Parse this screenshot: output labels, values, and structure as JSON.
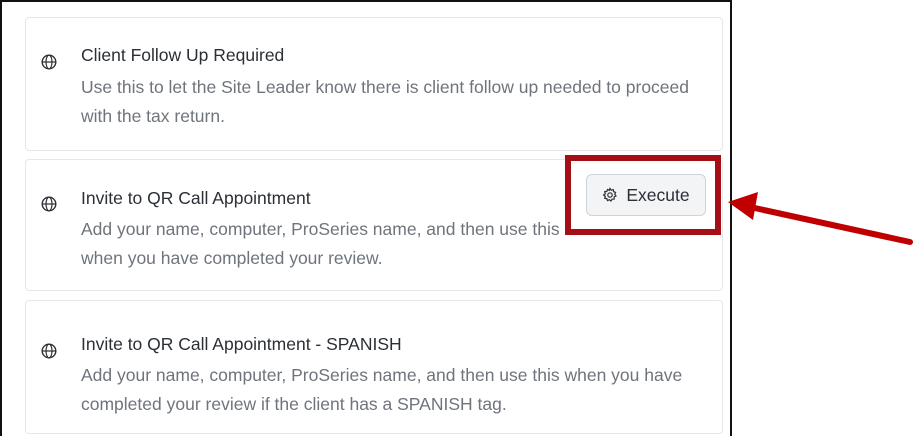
{
  "cards": [
    {
      "title": "Client Follow Up Required",
      "description": "Use this to let the Site Leader know there is client follow up needed to proceed with the tax return.",
      "icon": "globe-icon"
    },
    {
      "title": "Invite to QR Call Appointment",
      "description": "Add your name, computer, ProSeries name, and then use this when you have completed your review.",
      "icon": "globe-icon",
      "action_label": "Execute",
      "action_icon": "gear-icon"
    },
    {
      "title": "Invite to QR Call Appointment - SPANISH",
      "description": "Add your name, computer, ProSeries name, and then use this when you have completed your review if the client has a SPANISH tag.",
      "icon": "globe-icon"
    }
  ],
  "annotation": {
    "highlight_color": "#a50e14",
    "arrow_color": "#c00000"
  }
}
